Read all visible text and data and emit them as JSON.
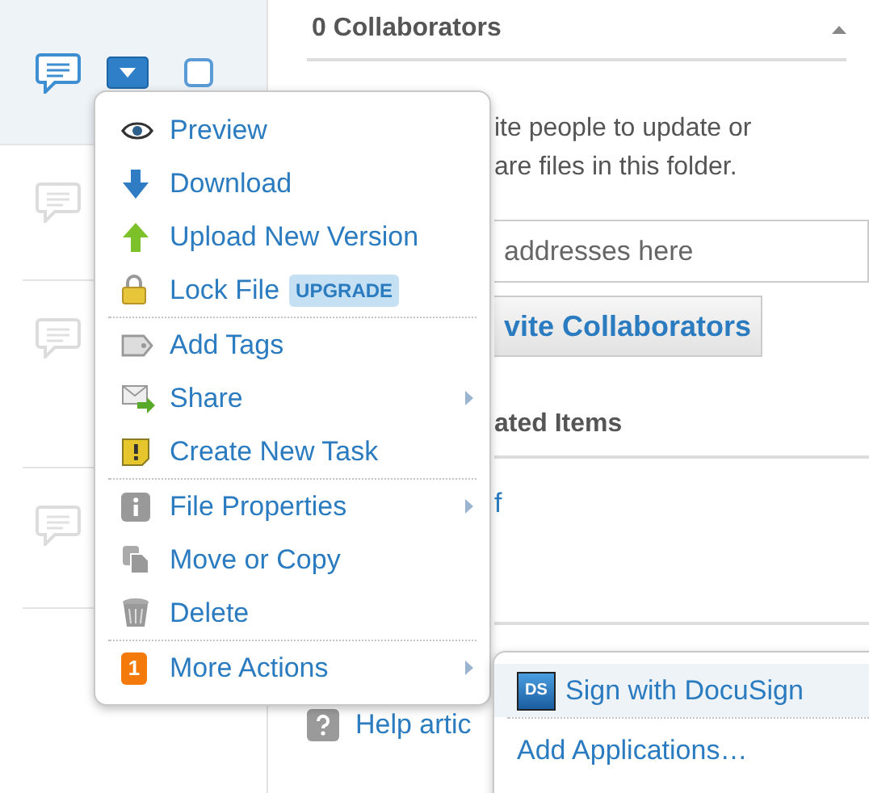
{
  "file_rows": [
    {
      "selected": true,
      "checked": false
    },
    {
      "selected": false
    },
    {
      "selected": false
    },
    {
      "selected": false
    }
  ],
  "collaborators": {
    "title": "0 Collaborators",
    "expanded": true
  },
  "invite_text": [
    "ite people to update or",
    "are files in this folder."
  ],
  "email_field": {
    "placeholder": "addresses here"
  },
  "invite_button": "vite Collaborators",
  "related": {
    "title": "ated Items",
    "items": [
      "f"
    ]
  },
  "help_links": [
    "Help artic"
  ],
  "menu": {
    "groups": [
      [
        {
          "label": "Preview",
          "submenu": false
        },
        {
          "label": "Download",
          "submenu": false
        },
        {
          "label": "Upload New Version",
          "submenu": false
        },
        {
          "label": "Lock File",
          "badge": "UPGRADE",
          "submenu": false
        }
      ],
      [
        {
          "label": "Add Tags",
          "submenu": false
        },
        {
          "label": "Share",
          "submenu": true
        },
        {
          "label": "Create New Task",
          "submenu": false
        }
      ],
      [
        {
          "label": "File Properties",
          "submenu": true
        },
        {
          "label": "Move or Copy",
          "submenu": false
        },
        {
          "label": "Delete",
          "submenu": false
        }
      ],
      [
        {
          "label": "More Actions",
          "count": "1",
          "submenu": true
        }
      ]
    ]
  },
  "submenu": {
    "items": [
      {
        "label": "Sign with DocuSign",
        "icon_text": "DS",
        "selected": true
      },
      {
        "label": "Add Applications…",
        "selected": false
      }
    ]
  }
}
